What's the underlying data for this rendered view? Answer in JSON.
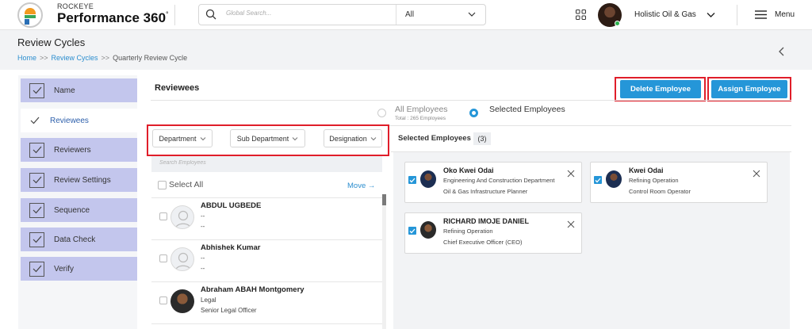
{
  "app": {
    "brand_small": "ROCKEYE",
    "brand_name": "Performance 360",
    "brand_sup": "°"
  },
  "topbar": {
    "search_placeholder": "Global Search...",
    "search_scope": "All",
    "org_name": "Holistic Oil & Gas",
    "menu_label": "Menu"
  },
  "page": {
    "title": "Review Cycles",
    "breadcrumb": [
      "Home",
      "Review Cycles",
      "Quarterly Review Cycle"
    ],
    "breadcrumb_sep": ">>"
  },
  "steps": [
    {
      "label": "Name",
      "active": false
    },
    {
      "label": "Reviewees",
      "active": true
    },
    {
      "label": "Reviewers",
      "active": false
    },
    {
      "label": "Review Settings",
      "active": false
    },
    {
      "label": "Sequence",
      "active": false
    },
    {
      "label": "Data Check",
      "active": false
    },
    {
      "label": "Verify",
      "active": false
    }
  ],
  "main": {
    "title": "Reviewees",
    "delete_label": "Delete Employee",
    "assign_label": "Assign Employee",
    "radio_all_label": "All Employees",
    "radio_all_sub": "Total : 265 Employees",
    "radio_selected_label": "Selected Employees",
    "radio_selected_value": "selected"
  },
  "filters": {
    "department": "Department",
    "sub_department": "Sub Department",
    "designation": "Designation",
    "search_placeholder": "Search Employees",
    "select_all": "Select All",
    "move": "Move →"
  },
  "employees": [
    {
      "name": "ABDUL UGBEDE",
      "line2": "--",
      "line3": "--",
      "photo": false
    },
    {
      "name": "Abhishek Kumar",
      "line2": "--",
      "line3": "--",
      "photo": false
    },
    {
      "name": "Abraham ABAH Montgomery",
      "line2": "Legal",
      "line3": "Senior Legal Officer",
      "photo": true
    }
  ],
  "selected": {
    "header": "Selected Employees",
    "count": "(3)",
    "cards": [
      {
        "name": "Oko Kwei Odai",
        "line2": "Engineering And Construction Department",
        "line3": "Oil & Gas Infrastructure Planner"
      },
      {
        "name": "Kwei Odai",
        "line2": "Refining Operation",
        "line3": "Control Room Operator"
      },
      {
        "name": "RICHARD IMOJE DANIEL",
        "line2": "Refining Operation",
        "line3": "Chief Executive Officer (CEO)"
      }
    ]
  },
  "colors": {
    "accent": "#2596d8",
    "highlight_outline": "#e01e2a",
    "step_bg": "#c3c6ed",
    "active_step_text": "#2d5fab"
  }
}
